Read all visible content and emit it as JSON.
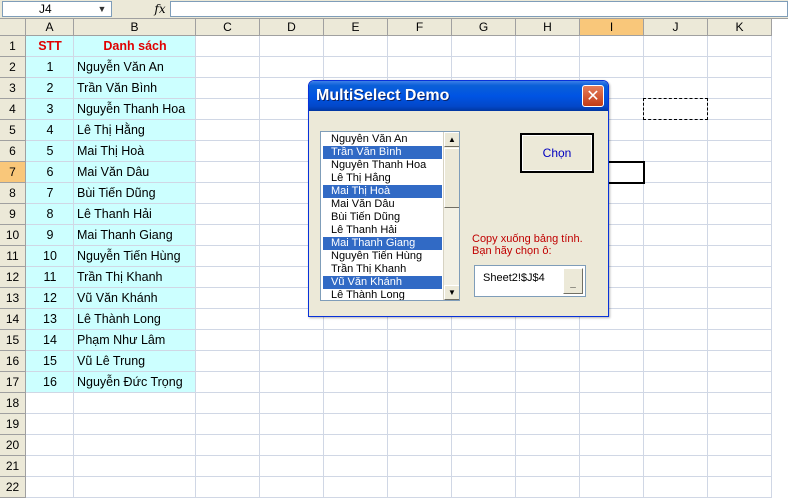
{
  "formula_bar": {
    "name_box": "J4",
    "fx_label": "fx",
    "formula": ""
  },
  "columns": [
    "A",
    "B",
    "C",
    "D",
    "E",
    "F",
    "G",
    "H",
    "I",
    "J",
    "K"
  ],
  "selected_column": "I",
  "rows": [
    "1",
    "2",
    "3",
    "4",
    "5",
    "6",
    "7",
    "8",
    "9",
    "10",
    "11",
    "12",
    "13",
    "14",
    "15",
    "16",
    "17",
    "18",
    "19",
    "20",
    "21",
    "22"
  ],
  "selected_row": "7",
  "sheet": {
    "header": {
      "stt": "STT",
      "name": "Danh sách"
    },
    "data": [
      {
        "stt": "1",
        "name": "Nguyễn Văn An"
      },
      {
        "stt": "2",
        "name": "Trần Văn Bình"
      },
      {
        "stt": "3",
        "name": "Nguyễn Thanh Hoa"
      },
      {
        "stt": "4",
        "name": "Lê Thị Hằng"
      },
      {
        "stt": "5",
        "name": "Mai Thị Hoà"
      },
      {
        "stt": "6",
        "name": "Mai Văn Dâu"
      },
      {
        "stt": "7",
        "name": "Bùi Tiến Dũng"
      },
      {
        "stt": "8",
        "name": "Lê Thanh Hải"
      },
      {
        "stt": "9",
        "name": "Mai Thanh Giang"
      },
      {
        "stt": "10",
        "name": "Nguyễn Tiến Hùng"
      },
      {
        "stt": "11",
        "name": "Trần Thị Khanh"
      },
      {
        "stt": "12",
        "name": "Vũ Văn Khánh"
      },
      {
        "stt": "13",
        "name": "Lê Thành Long"
      },
      {
        "stt": "14",
        "name": "Phạm Như Lâm"
      },
      {
        "stt": "15",
        "name": "Vũ Lê Trung"
      },
      {
        "stt": "16",
        "name": "Nguyễn Đức Trọng"
      }
    ]
  },
  "dialog": {
    "title": "MultiSelect Demo",
    "close_glyph": "✕",
    "list_items": [
      {
        "label": "Nguyễn Văn An",
        "selected": false
      },
      {
        "label": "Trần Văn Bình",
        "selected": true
      },
      {
        "label": "Nguyễn Thanh Hoa",
        "selected": false
      },
      {
        "label": "Lê Thị Hằng",
        "selected": false
      },
      {
        "label": "Mai Thị Hoà",
        "selected": true
      },
      {
        "label": "Mai Văn Dâu",
        "selected": false
      },
      {
        "label": "Bùi Tiến Dũng",
        "selected": false
      },
      {
        "label": "Lê Thanh Hải",
        "selected": false
      },
      {
        "label": "Mai Thanh Giang",
        "selected": true
      },
      {
        "label": "Nguyễn Tiến Hùng",
        "selected": false
      },
      {
        "label": "Trần Thị Khanh",
        "selected": false
      },
      {
        "label": "Vũ Văn Khánh",
        "selected": true
      },
      {
        "label": "Lê Thành Long",
        "selected": false
      }
    ],
    "choose_button": "Chọn",
    "note_line1": "Copy xuống bảng tính.",
    "note_line2": "Bạn hãy chọn ô:",
    "ref_value": "Sheet2!$J$4",
    "ref_button": "_"
  },
  "colors": {
    "header_red": "#e00000",
    "cyan_fill": "#ccffff",
    "selection_blue": "#316ac5",
    "title_blue": "#0054e3"
  }
}
